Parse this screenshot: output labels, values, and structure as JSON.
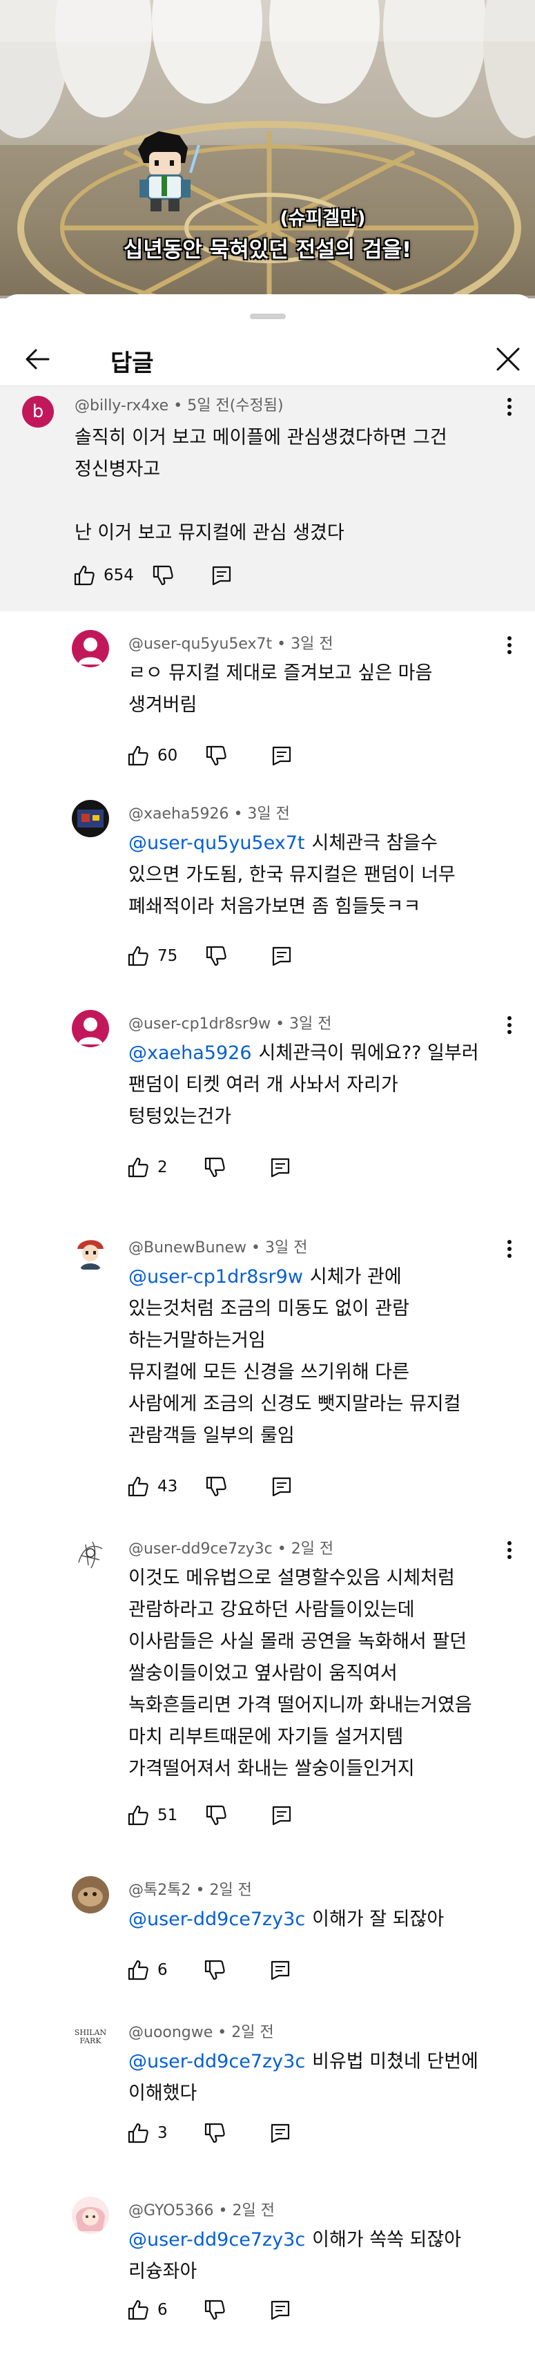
{
  "video": {
    "caption_line1": "(슈피겔만)",
    "caption_line2": "십년동안 묵혀있던 전설의 검을!",
    "progress": 0.0
  },
  "sheet": {
    "title": "답글",
    "icons": {
      "back": "back-arrow-icon",
      "close": "close-icon"
    }
  },
  "parent_comment": {
    "avatar_letter": "b",
    "avatar_color": "#c2185b",
    "author": "@billy-rx4xe",
    "time": "5일 전(수정됨)",
    "lines": [
      "솔직히 이거 보고 메이플에 관심생겼다하면 그건",
      "정신병자고",
      "",
      "난 이거 보고 뮤지컬에 관심 생겼다"
    ],
    "likes": "654"
  },
  "replies": [
    {
      "author": "@user-qu5yu5ex7t",
      "time": "3일 전",
      "avatar": "default-avatar",
      "mention": "",
      "lines": [
        "ㄹㅇ 뮤지컬 제대로 즐겨보고 싶은 마음",
        "생겨버림"
      ],
      "likes": "60"
    },
    {
      "author": "@xaeha5926",
      "time": "3일 전",
      "avatar": "game-avatar",
      "mention": "@user-qu5yu5ex7t",
      "lines": [
        "시체관극 참을수",
        "있으면 가도됨, 한국 뮤지컬은 팬덤이 너무",
        "폐쇄적이라 처음가보면 좀 힘들듯ㅋㅋ"
      ],
      "likes": "75"
    },
    {
      "author": "@user-cp1dr8sr9w",
      "time": "3일 전",
      "avatar": "default-avatar",
      "mention": "@xaeha5926",
      "lines": [
        "시체관극이 뭐에요?? 일부러",
        "팬덤이 티켓 여러 개 사놔서 자리가",
        "텅텅있는건가"
      ],
      "likes": "2"
    },
    {
      "author": "@BunewBunew",
      "time": "3일 전",
      "avatar": "character-avatar",
      "mention": "@user-cp1dr8sr9w",
      "lines": [
        "시체가 관에",
        "있는것처럼 조금의 미동도 없이 관람",
        "하는거말하는거임",
        "뮤지컬에 모든 신경을 쓰기위해 다른",
        "사람에게 조금의 신경도 뺏지말라는 뮤지컬",
        "관람객들 일부의 룰임"
      ],
      "likes": "43"
    },
    {
      "author": "@user-dd9ce7zy3c",
      "time": "2일 전",
      "avatar": "sketch-avatar",
      "mention": "",
      "lines": [
        "이것도 메유법으로 설명할수있음 시체처럼",
        "관람하라고 강요하던 사람들이있는데",
        "이사람들은 사실 몰래 공연을 녹화해서 팔던",
        "쌀숭이들이었고 옆사람이 움직여서",
        "녹화흔들리면 가격 떨어지니까 화내는거였음",
        "마치 리부트때문에 자기들 설거지템",
        "가격떨어져서 화내는 쌀숭이들인거지"
      ],
      "likes": "51"
    },
    {
      "author": "@톡2톡2",
      "time": "2일 전",
      "avatar": "photo-avatar",
      "mention": "@user-dd9ce7zy3c",
      "lines": [
        "이해가 잘 되잖아"
      ],
      "likes": "6"
    },
    {
      "author": "@uoongwe",
      "time": "2일 전",
      "avatar": "text-logo-avatar",
      "avatar_text": "SHILAN FARK",
      "mention": "@user-dd9ce7zy3c",
      "lines": [
        "비유법 미쳤네 단번에",
        "이해했다"
      ],
      "likes": "3"
    },
    {
      "author": "@GYO5366",
      "time": "2일 전",
      "avatar": "anime-avatar",
      "mention": "@user-dd9ce7zy3c",
      "lines": [
        "이해가 쏙쏙 되잖아",
        "리슝좌아"
      ],
      "likes": "6"
    }
  ]
}
